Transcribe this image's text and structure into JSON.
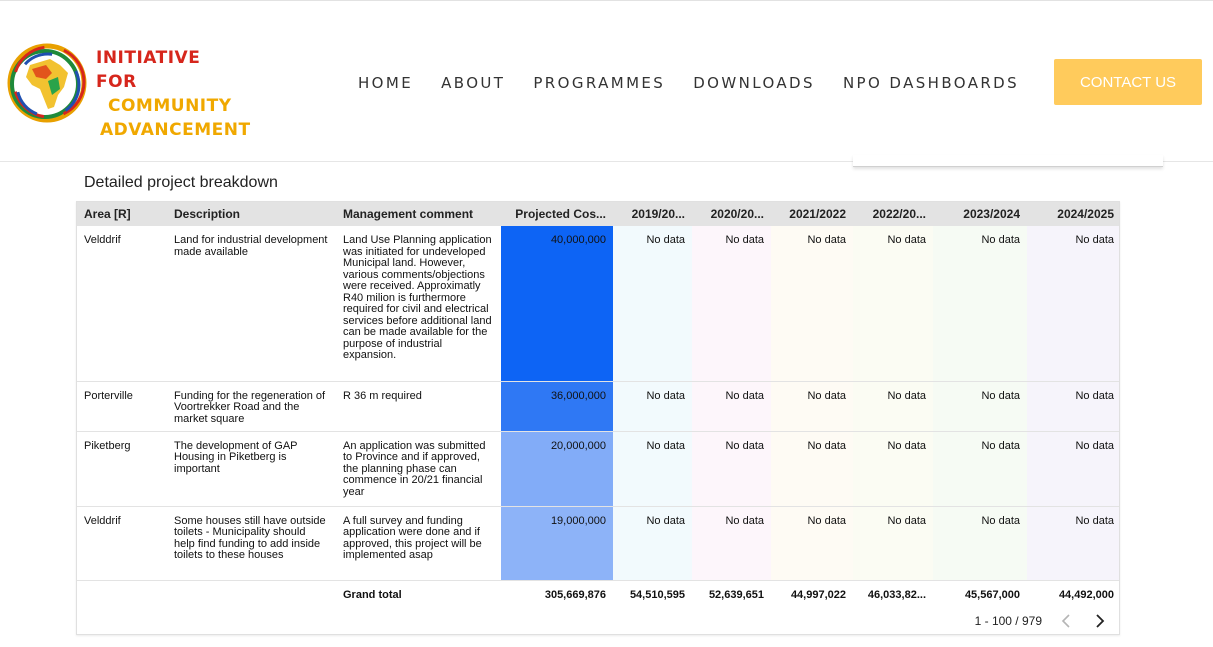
{
  "header": {
    "logo": {
      "line1": "INITIATIVE FOR",
      "line2": "COMMUNITY",
      "line3": "ADVANCEMENT"
    },
    "nav": [
      "HOME",
      "ABOUT",
      "PROGRAMMES",
      "DOWNLOADS",
      "NPO DASHBOARDS"
    ],
    "contact_label": "CONTACT US",
    "colors": {
      "contact_bg": "#ffcb5c",
      "logo_red": "#d6261c",
      "logo_yellow": "#f0a800"
    }
  },
  "table": {
    "title": "Detailed project breakdown",
    "columns": [
      "Area [R]",
      "Description",
      "Management comment",
      "Projected Cos...",
      "2019/20...",
      "2020/20...",
      "2021/2022",
      "2022/20...",
      "2023/2024",
      "2024/2025"
    ],
    "rows": [
      {
        "area": "Velddrif",
        "description": "Land for industrial development made available",
        "comment": "Land Use Planning application was initiated for undeveloped Municipal land. However, various comments/objections were received. Approximatly R40 milion is furthermore required for civil and electrical services before additional land can be made available for the purpose of industrial expansion.",
        "projected": "40,000,000",
        "years": [
          "No data",
          "No data",
          "No data",
          "No data",
          "No data",
          "No data"
        ]
      },
      {
        "area": "Porterville",
        "description": "Funding for the regeneration of Voortrekker Road and the market square",
        "comment": "R 36 m required",
        "projected": "36,000,000",
        "years": [
          "No data",
          "No data",
          "No data",
          "No data",
          "No data",
          "No data"
        ]
      },
      {
        "area": "Piketberg",
        "description": "The development of GAP Housing in Piketberg is important",
        "comment": "An application was submitted to Province and if approved, the planning phase can commence in 20/21 financial year",
        "projected": "20,000,000",
        "years": [
          "No data",
          "No data",
          "No data",
          "No data",
          "No data",
          "No data"
        ]
      },
      {
        "area": "Velddrif",
        "description": "Some houses still have outside toilets - Municipality should help find funding to add inside toilets to these houses",
        "comment": "A full survey and funding application were done and if approved, this project will be implemented asap",
        "projected": "19,000,000",
        "years": [
          "No data",
          "No data",
          "No data",
          "No data",
          "No data",
          "No data"
        ]
      }
    ],
    "total": {
      "label": "Grand total",
      "projected": "305,669,876",
      "years": [
        "54,510,595",
        "52,639,651",
        "44,997,022",
        "46,033,82...",
        "45,567,000",
        "44,492,000"
      ]
    },
    "pagination": "1 - 100 / 979"
  }
}
